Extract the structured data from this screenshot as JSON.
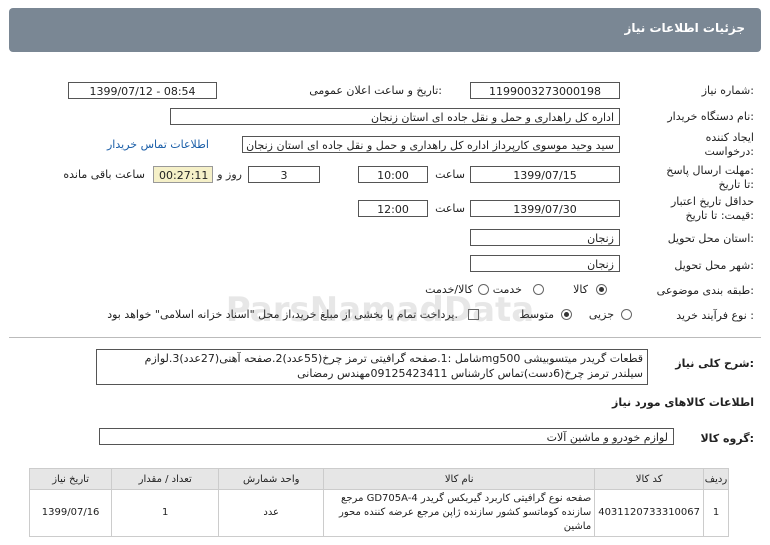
{
  "header": {
    "title": "جزئیات اطلاعات نیاز"
  },
  "fields": {
    "need_number_label": "شماره نیاز:",
    "need_number": "1199003273000198",
    "announce_label": "تاریخ و ساعت اعلان عمومی:",
    "announce_value": "1399/07/12 - 08:54",
    "buyer_label": "نام دستگاه خریدار:",
    "buyer_value": "اداره کل راهداری و حمل و نقل جاده ای استان زنجان",
    "creator_label_1": "ایجاد کننده",
    "creator_label_2": "درخواست:",
    "creator_value": "سید وحید موسوی کارپرداز اداره کل راهداری و حمل و نقل جاده ای استان زنجان",
    "contact_link": "اطلاعات تماس خریدار",
    "deadline_label_1": "مهلت ارسال پاسخ:",
    "deadline_label_2": "تا تاریخ:",
    "deadline_date": "1399/07/15",
    "time_label": "ساعت",
    "deadline_time": "10:00",
    "days_value": "3",
    "days_label": "روز و",
    "remaining_time": "00:27:11",
    "remaining_label": "ساعت باقی مانده",
    "validity_label_1": "حداقل تاریخ اعتبار",
    "validity_label_2": "قیمت: تا تاریخ:",
    "validity_date": "1399/07/30",
    "validity_time": "12:00",
    "province_label": "استان محل تحویل:",
    "province_value": "زنجان",
    "city_label": "شهر محل تحویل:",
    "city_value": "زنجان",
    "category_label": "طبقه بندی موضوعی:",
    "cat_goods": "کالا",
    "cat_service": "خدمت",
    "cat_goods_service": "کالا/خدمت",
    "process_label": "نوع فرآیند خرید :",
    "proc_partial": "جزیی",
    "proc_medium": "متوسط",
    "payment_note": "پرداخت تمام یا بخشی از مبلغ خرید،از محل \"اسناد خزانه اسلامی\" خواهد بود."
  },
  "description": {
    "label": "شرح کلی نیاز:",
    "line1": "قطعات  گریدر میتسوبیشی mg500شامل :1.صفحه گرافیتی ترمز چرخ(55عدد)2.صفحه آهنی(27عدد)3.لوازم",
    "line2": "سیلندر ترمز چرخ(6دست)تماس کارشناس 09125423411مهندس رمضانی"
  },
  "goods_section": {
    "title": "اطلاعات کالاهای مورد نیاز",
    "group_label": "گروه کالا:",
    "group_value": "لوازم خودرو و ماشین آلات"
  },
  "table": {
    "headers": [
      "ردیف",
      "کد کالا",
      "نام کالا",
      "واحد شمارش",
      "تعداد / مقدار",
      "تاریخ نیاز"
    ],
    "rows": [
      {
        "row": "1",
        "code": "4031120733310067",
        "name": "صفحه نوع گرافیتی کاربرد گیربکس گریدر GD705A-4 مرجع سازنده کوماتسو کشور سازنده ژاپن مرجع عرضه کننده محور ماشین",
        "unit": "عدد",
        "qty": "1",
        "date": "1399/07/16"
      }
    ]
  },
  "watermark": "ParsNamadData"
}
